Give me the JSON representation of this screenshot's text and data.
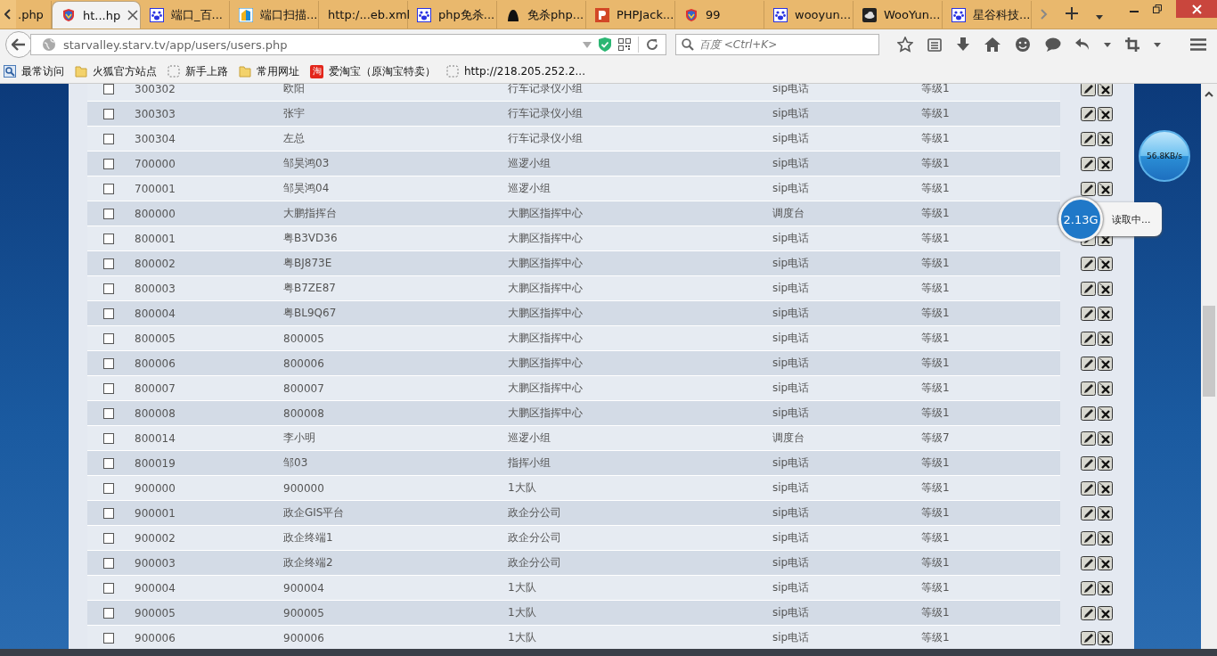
{
  "tabs": [
    {
      "title": ".php",
      "kind": "plain",
      "selected": false
    },
    {
      "title": "ht...hp",
      "kind": "shield",
      "selected": true
    },
    {
      "title": "端口_百...",
      "kind": "paw",
      "selected": false
    },
    {
      "title": "端口扫描...",
      "kind": "tile",
      "selected": false
    },
    {
      "title": "http:/...eb.xml",
      "kind": "plain",
      "selected": false
    },
    {
      "title": "php免杀...",
      "kind": "paw",
      "selected": false
    },
    {
      "title": "免杀php...",
      "kind": "hat",
      "selected": false
    },
    {
      "title": "PHPJack...",
      "kind": "brand",
      "selected": false
    },
    {
      "title": "99",
      "kind": "shield",
      "selected": false
    },
    {
      "title": "wooyun...",
      "kind": "paw",
      "selected": false
    },
    {
      "title": "WooYun...",
      "kind": "cloud",
      "selected": false
    },
    {
      "title": "星谷科技...",
      "kind": "paw",
      "selected": false
    }
  ],
  "address": {
    "url": "starvalley.starv.tv/app/users/users.php"
  },
  "search": {
    "placeholder": "百度 <Ctrl+K>"
  },
  "bookmarks": [
    {
      "label": "最常访问",
      "kind": "search"
    },
    {
      "label": "火狐官方站点",
      "kind": "folder"
    },
    {
      "label": "新手上路",
      "kind": "page"
    },
    {
      "label": "常用网址",
      "kind": "folder"
    },
    {
      "label": "爱淘宝（原淘宝特卖）",
      "kind": "badge",
      "badge": "淘"
    },
    {
      "label": "http://218.205.252.2...",
      "kind": "page"
    }
  ],
  "rows": [
    {
      "checked": false,
      "id": "300302",
      "name": "欧阳",
      "group": "行车记录仪小组",
      "type": "sip电话",
      "level": "等级1"
    },
    {
      "checked": false,
      "id": "300303",
      "name": "张宇",
      "group": "行车记录仪小组",
      "type": "sip电话",
      "level": "等级1"
    },
    {
      "checked": false,
      "id": "300304",
      "name": "左总",
      "group": "行车记录仪小组",
      "type": "sip电话",
      "level": "等级1"
    },
    {
      "checked": false,
      "id": "700000",
      "name": "邹昊鸿03",
      "group": "巡逻小组",
      "type": "sip电话",
      "level": "等级1"
    },
    {
      "checked": false,
      "id": "700001",
      "name": "邹昊鸿04",
      "group": "巡逻小组",
      "type": "sip电话",
      "level": "等级1"
    },
    {
      "checked": false,
      "id": "800000",
      "name": "大鹏指挥台",
      "group": "大鹏区指挥中心",
      "type": "调度台",
      "level": "等级1"
    },
    {
      "checked": false,
      "id": "800001",
      "name": "粤B3VD36",
      "group": "大鹏区指挥中心",
      "type": "sip电话",
      "level": "等级1"
    },
    {
      "checked": false,
      "id": "800002",
      "name": "粤BJ873E",
      "group": "大鹏区指挥中心",
      "type": "sip电话",
      "level": "等级1"
    },
    {
      "checked": false,
      "id": "800003",
      "name": "粤B7ZE87",
      "group": "大鹏区指挥中心",
      "type": "sip电话",
      "level": "等级1"
    },
    {
      "checked": false,
      "id": "800004",
      "name": "粤BL9Q67",
      "group": "大鹏区指挥中心",
      "type": "sip电话",
      "level": "等级1"
    },
    {
      "checked": false,
      "id": "800005",
      "name": "800005",
      "group": "大鹏区指挥中心",
      "type": "sip电话",
      "level": "等级1"
    },
    {
      "checked": false,
      "id": "800006",
      "name": "800006",
      "group": "大鹏区指挥中心",
      "type": "sip电话",
      "level": "等级1"
    },
    {
      "checked": false,
      "id": "800007",
      "name": "800007",
      "group": "大鹏区指挥中心",
      "type": "sip电话",
      "level": "等级1"
    },
    {
      "checked": false,
      "id": "800008",
      "name": "800008",
      "group": "大鹏区指挥中心",
      "type": "sip电话",
      "level": "等级1"
    },
    {
      "checked": false,
      "id": "800014",
      "name": "李小明",
      "group": "巡逻小组",
      "type": "调度台",
      "level": "等级7"
    },
    {
      "checked": false,
      "id": "800019",
      "name": "邹03",
      "group": "指挥小组",
      "type": "sip电话",
      "level": "等级1"
    },
    {
      "checked": false,
      "id": "900000",
      "name": "900000",
      "group": "1大队",
      "type": "sip电话",
      "level": "等级1"
    },
    {
      "checked": false,
      "id": "900001",
      "name": "政企GIS平台",
      "group": "政企分公司",
      "type": "sip电话",
      "level": "等级1"
    },
    {
      "checked": false,
      "id": "900002",
      "name": "政企终端1",
      "group": "政企分公司",
      "type": "sip电话",
      "level": "等级1"
    },
    {
      "checked": false,
      "id": "900003",
      "name": "政企终端2",
      "group": "政企分公司",
      "type": "sip电话",
      "level": "等级1"
    },
    {
      "checked": false,
      "id": "900004",
      "name": "900004",
      "group": "1大队",
      "type": "sip电话",
      "level": "等级1"
    },
    {
      "checked": false,
      "id": "900005",
      "name": "900005",
      "group": "1大队",
      "type": "sip电话",
      "level": "等级1"
    },
    {
      "checked": false,
      "id": "900006",
      "name": "900006",
      "group": "1大队",
      "type": "sip电话",
      "level": "等级1"
    }
  ],
  "speed_widget": {
    "speed": "56.8KB/s",
    "memory": "2.13G",
    "status": "读取中..."
  }
}
